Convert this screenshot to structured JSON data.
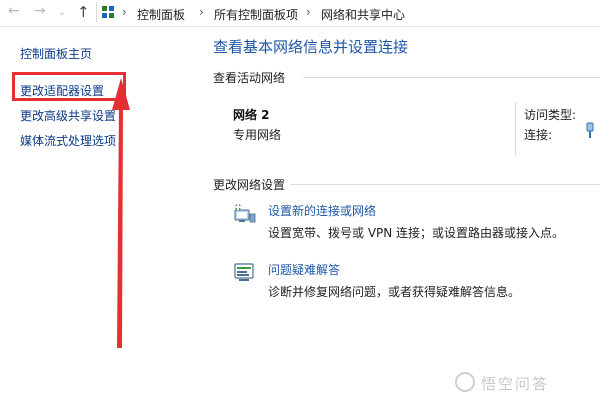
{
  "address_bar": {
    "breadcrumbs": [
      "控制面板",
      "所有控制面板项",
      "网络和共享中心"
    ],
    "separator": "›"
  },
  "sidebar": {
    "items": [
      {
        "label": "控制面板主页"
      },
      {
        "label": "更改适配器设置",
        "highlighted": true
      },
      {
        "label": "更改高级共享设置"
      },
      {
        "label": "媒体流式处理选项"
      }
    ]
  },
  "main": {
    "title": "查看基本网络信息并设置连接",
    "active_networks": {
      "heading": "查看活动网络",
      "network_name": "网络  2",
      "network_type": "专用网络",
      "access_type_label": "访问类型:",
      "connection_label": "连接:"
    },
    "change_settings": {
      "heading": "更改网络设置",
      "tasks": [
        {
          "link": "设置新的连接或网络",
          "description": "设置宽带、拨号或 VPN 连接；或设置路由器或接入点。",
          "icon": "new-connection-icon"
        },
        {
          "link": "问题疑难解答",
          "description": "诊断并修复网络问题，或者获得疑难解答信息。",
          "icon": "troubleshoot-icon"
        }
      ]
    }
  },
  "annotation": {
    "box_color": "#e52f33",
    "arrow_color": "#e52f33"
  },
  "watermark": {
    "text": "悟空问答"
  },
  "colors": {
    "link": "#1f57a8",
    "sidebar_link": "#0b3a86",
    "highlight": "#e52f33"
  }
}
